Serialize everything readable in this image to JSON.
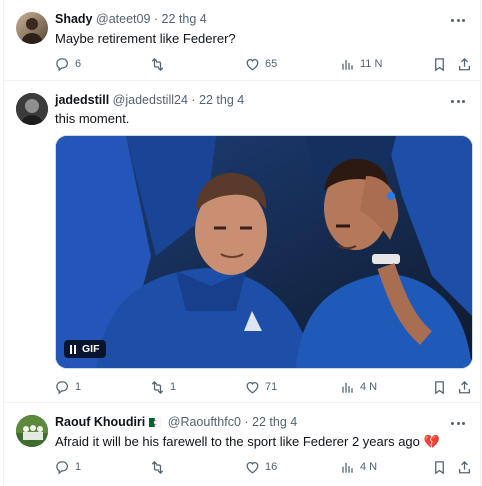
{
  "tweets": [
    {
      "name": "Shady",
      "handle": "@ateet09",
      "separator": "·",
      "date": "22 thg 4",
      "text": "Maybe retirement like Federer?",
      "replies": "6",
      "retweets": "",
      "likes": "65",
      "views": "11 N"
    },
    {
      "name": "jadedstill",
      "handle": "@jadedstill24",
      "separator": "·",
      "date": "22 thg 4",
      "text": "this moment.",
      "gif_label": "GIF",
      "replies": "1",
      "retweets": "1",
      "likes": "71",
      "views": "4 N"
    },
    {
      "name": "Raouf Khoudiri",
      "handle": "@Raoufthfc0",
      "separator": "·",
      "date": "22 thg 4",
      "text": "Afraid it will be his farewell to the sport like Federer 2 years ago 💔",
      "replies": "1",
      "retweets": "",
      "likes": "16",
      "views": "4 N"
    }
  ],
  "icons": {
    "reply": "reply-icon",
    "retweet": "retweet-icon",
    "like": "heart-icon",
    "views": "views-icon",
    "bookmark": "bookmark-icon",
    "share": "share-icon",
    "more": "more-icon"
  },
  "colors": {
    "text_primary": "#0f1419",
    "text_secondary": "#536471",
    "border": "#eff3f4",
    "laver_cup_blue": "#1e4fa8"
  }
}
